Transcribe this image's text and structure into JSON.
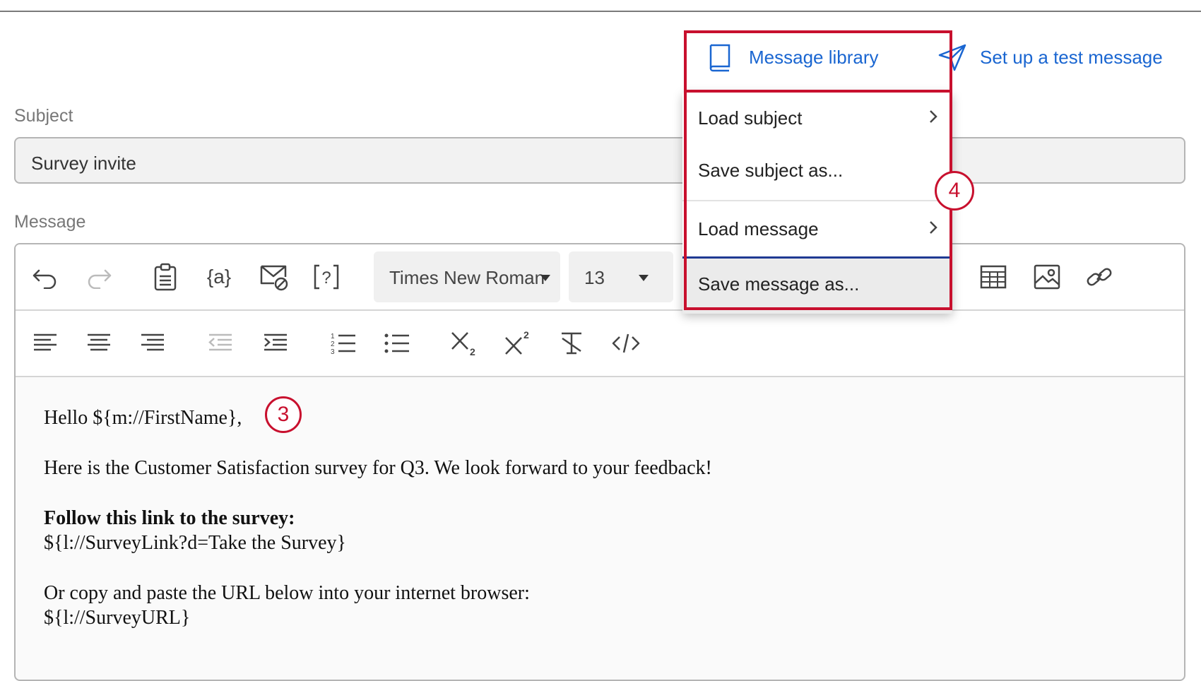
{
  "header": {
    "message_library_label": "Message library",
    "test_message_label": "Set up a test message"
  },
  "subject": {
    "label": "Subject",
    "value": "Survey invite"
  },
  "message": {
    "label": "Message",
    "toolbar": {
      "font_family": "Times New Roman",
      "font_size": "13",
      "row1_icons": [
        "undo-icon",
        "redo-icon",
        "paste-icon",
        "piped-text-icon",
        "email-icon",
        "question-icon",
        "table-icon",
        "image-icon",
        "link-icon"
      ],
      "row2_icons": [
        "align-left-icon",
        "align-center-icon",
        "align-right-icon",
        "outdent-icon",
        "indent-icon",
        "numbered-list-icon",
        "bullet-list-icon",
        "subscript-icon",
        "superscript-icon",
        "clear-format-icon",
        "source-code-icon"
      ]
    },
    "body": {
      "greeting": "Hello ${m://FirstName},",
      "intro": "Here is the Customer Satisfaction survey for Q3. We look forward to your feedback!",
      "link_heading": "Follow this link to the survey:",
      "survey_link": "${l://SurveyLink?d=Take the Survey}",
      "copy_instructions": "Or copy and paste the URL below into your internet browser:",
      "survey_url": "${l://SurveyURL}"
    }
  },
  "library_menu": {
    "items": [
      "Load subject",
      "Save subject as...",
      "Load message",
      "Save message as..."
    ]
  },
  "annotations": {
    "step_3": "3",
    "step_4": "4",
    "highlight_color": "#c8102e"
  },
  "colors": {
    "link": "#1a66d1",
    "hover_border": "#1f3a93"
  }
}
